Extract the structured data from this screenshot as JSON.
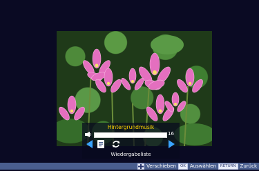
{
  "overlay": {
    "title": "Hintergrundmusik",
    "volume_value": "16",
    "volume_level_fraction": 0.15,
    "playlist_label": "Wiedergabeliste"
  },
  "photo": {
    "subject": "pink water lilies among green lily pads"
  },
  "bottom_bar": {
    "move_label": "Verschieben",
    "ok_key": "OK",
    "select_label": "Auswählen",
    "return_key": "RETURN",
    "back_label": "Zurück"
  },
  "icons": {
    "speaker": "speaker-icon",
    "prev": "left-arrow-icon",
    "playlist": "playlist-icon",
    "repeat": "repeat-icon",
    "next": "right-arrow-icon",
    "dpad": "dpad-icon"
  },
  "colors": {
    "background": "#0a0a23",
    "title": "#ffd400",
    "arrow": "#3aa3ff",
    "bottom_bar": "#4a5e8e"
  }
}
